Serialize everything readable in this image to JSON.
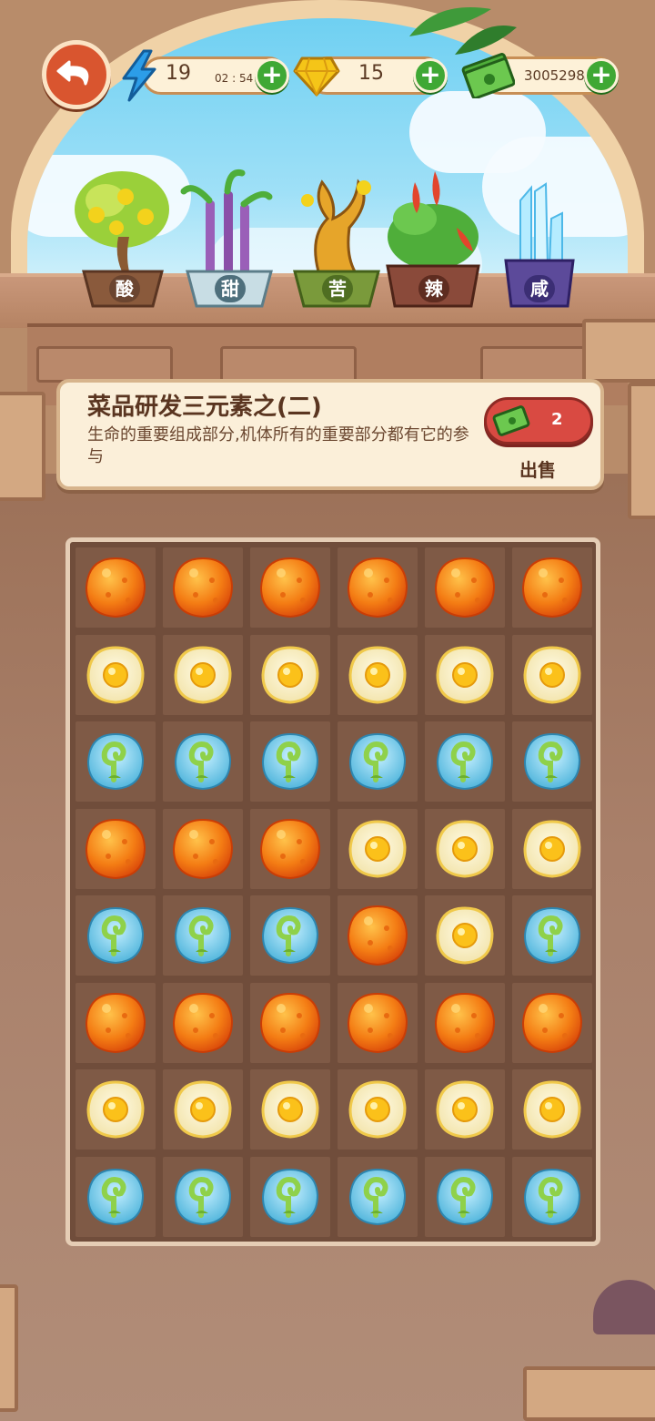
{
  "top_bar": {
    "energy": {
      "value": "19",
      "timer": "02 : 54"
    },
    "gems": {
      "value": "15"
    },
    "cash": {
      "value": "3005298"
    }
  },
  "plants": [
    {
      "label": "酸",
      "label_color": "#8a5a3c"
    },
    {
      "label": "甜",
      "label_color": "#6b8d9a"
    },
    {
      "label": "苦",
      "label_color": "#7a9a3b"
    },
    {
      "label": "辣",
      "label_color": "#8a4a3a"
    },
    {
      "label": "咸",
      "label_color": "#5c4a9a"
    }
  ],
  "info": {
    "title": "菜品研发三元素之(二)",
    "description": "生命的重要组成部分,机体所有的重要部分都有它的参与",
    "sell_count": "2",
    "sell_label": "出售"
  },
  "board": {
    "rows": [
      [
        "orange",
        "orange",
        "orange",
        "orange",
        "orange",
        "orange"
      ],
      [
        "egg",
        "egg",
        "egg",
        "egg",
        "egg",
        "egg"
      ],
      [
        "sprout",
        "sprout",
        "sprout",
        "sprout",
        "sprout",
        "sprout"
      ],
      [
        "orange",
        "orange",
        "orange",
        "egg",
        "egg",
        "egg"
      ],
      [
        "sprout",
        "sprout",
        "sprout",
        "orange",
        "egg",
        "sprout"
      ],
      [
        "orange",
        "orange",
        "orange",
        "orange",
        "orange",
        "orange"
      ],
      [
        "egg",
        "egg",
        "egg",
        "egg",
        "egg",
        "egg"
      ],
      [
        "sprout",
        "sprout",
        "sprout",
        "sprout",
        "sprout",
        "sprout"
      ]
    ]
  },
  "colors": {
    "accent_green": "#3fa834",
    "sell_red": "#d94a42",
    "back_orange": "#d9552f"
  }
}
